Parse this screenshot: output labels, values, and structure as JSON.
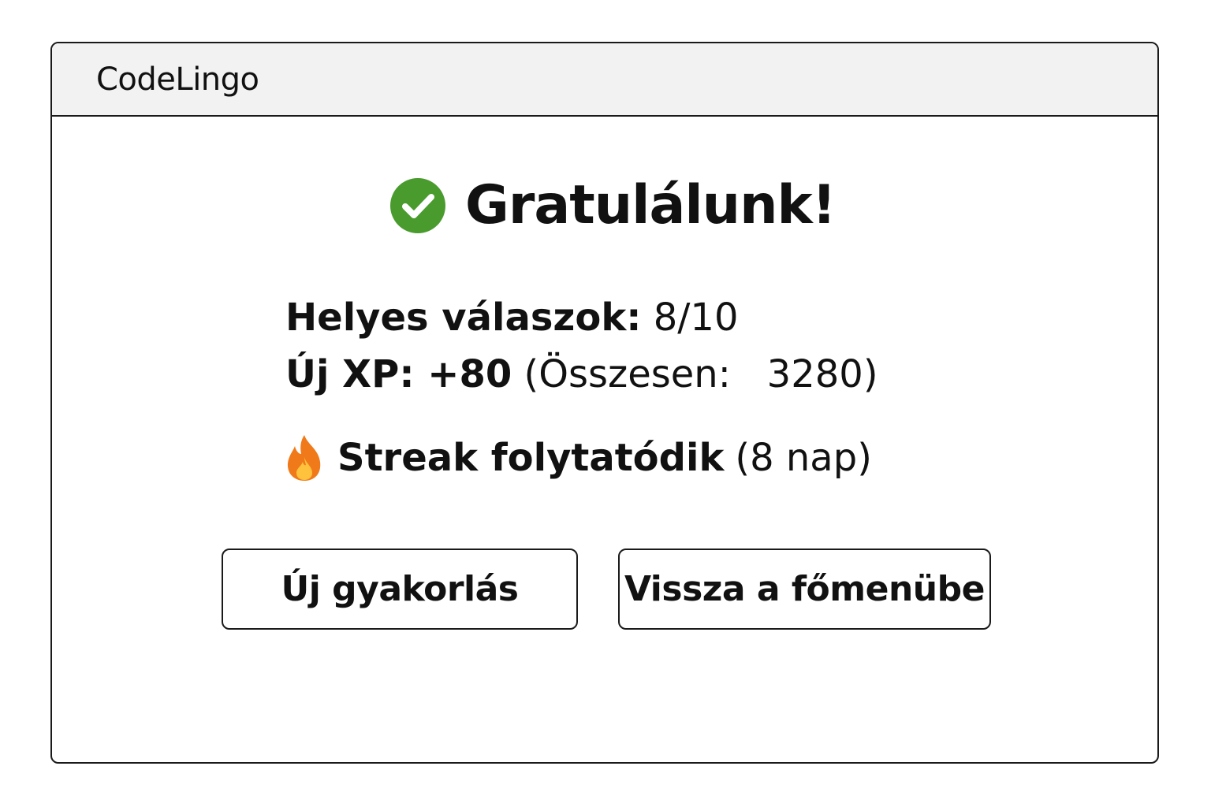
{
  "app": {
    "title": "CodeLingo"
  },
  "result": {
    "heading": "Gratulálunk!",
    "heading_icon": "check-circle-icon",
    "correct_label": "Helyes válaszok:",
    "correct_value": "8/10",
    "xp_label": "Új XP: +80",
    "xp_total_text": "(Összesen:   3280)",
    "streak_icon": "fire-icon",
    "streak_label": "Streak folytatódik",
    "streak_days_text": "(8 nap)"
  },
  "buttons": {
    "new_practice": "Új gyakorlás",
    "back_to_menu": "Vissza a főmenübe"
  },
  "colors": {
    "check": "#4a9b2e",
    "fire_outer": "#f07a1a",
    "fire_inner": "#ffc23d",
    "titlebar_bg": "#f2f2f2",
    "border": "#1a1a1a"
  }
}
